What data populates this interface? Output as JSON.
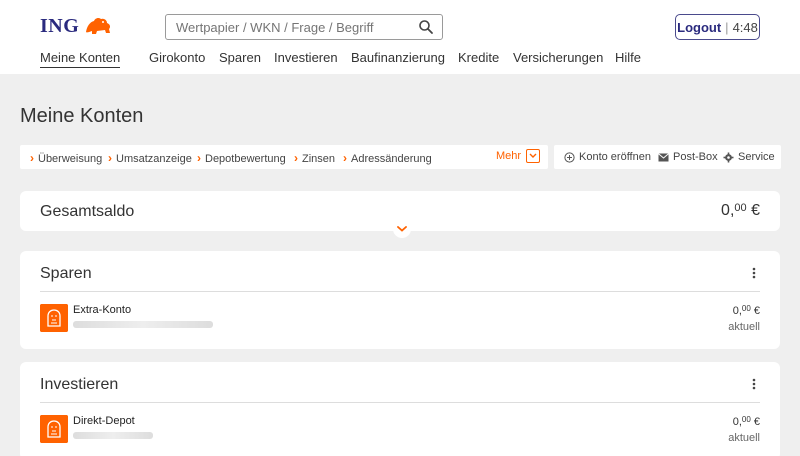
{
  "brand": {
    "name": "ING",
    "accent": "#ff6200",
    "navy": "#2a2a7e"
  },
  "search": {
    "placeholder": "Wertpapier / WKN / Frage / Begriff",
    "icon": "search-icon"
  },
  "logout": {
    "label": "Logout",
    "timer": "4:48"
  },
  "nav": {
    "items": [
      "Meine Konten",
      "Girokonto",
      "Sparen",
      "Investieren",
      "Baufinanzierung",
      "Kredite",
      "Versicherungen",
      "Hilfe"
    ],
    "active": "Meine Konten"
  },
  "page": {
    "title": "Meine Konten"
  },
  "quicklinks": {
    "items": [
      "Überweisung",
      "Umsatzanzeige",
      "Depotbewertung",
      "Zinsen",
      "Adressänderung"
    ],
    "more": "Mehr"
  },
  "service": {
    "items": [
      {
        "label": "Konto eröffnen",
        "icon": "plus-circle-icon"
      },
      {
        "label": "Post-Box",
        "icon": "mail-icon"
      },
      {
        "label": "Service",
        "icon": "gear-icon"
      }
    ]
  },
  "total": {
    "label": "Gesamtsaldo",
    "value_int": "0,",
    "value_dec": "00",
    "currency": "€"
  },
  "sections": [
    {
      "title": "Sparen",
      "account": {
        "name": "Extra-Konto",
        "amount_int": "0,",
        "amount_dec": "00",
        "currency": "€",
        "status": "aktuell"
      }
    },
    {
      "title": "Investieren",
      "account": {
        "name": "Direkt-Depot",
        "amount_int": "0,",
        "amount_dec": "00",
        "currency": "€",
        "status": "aktuell"
      }
    }
  ]
}
